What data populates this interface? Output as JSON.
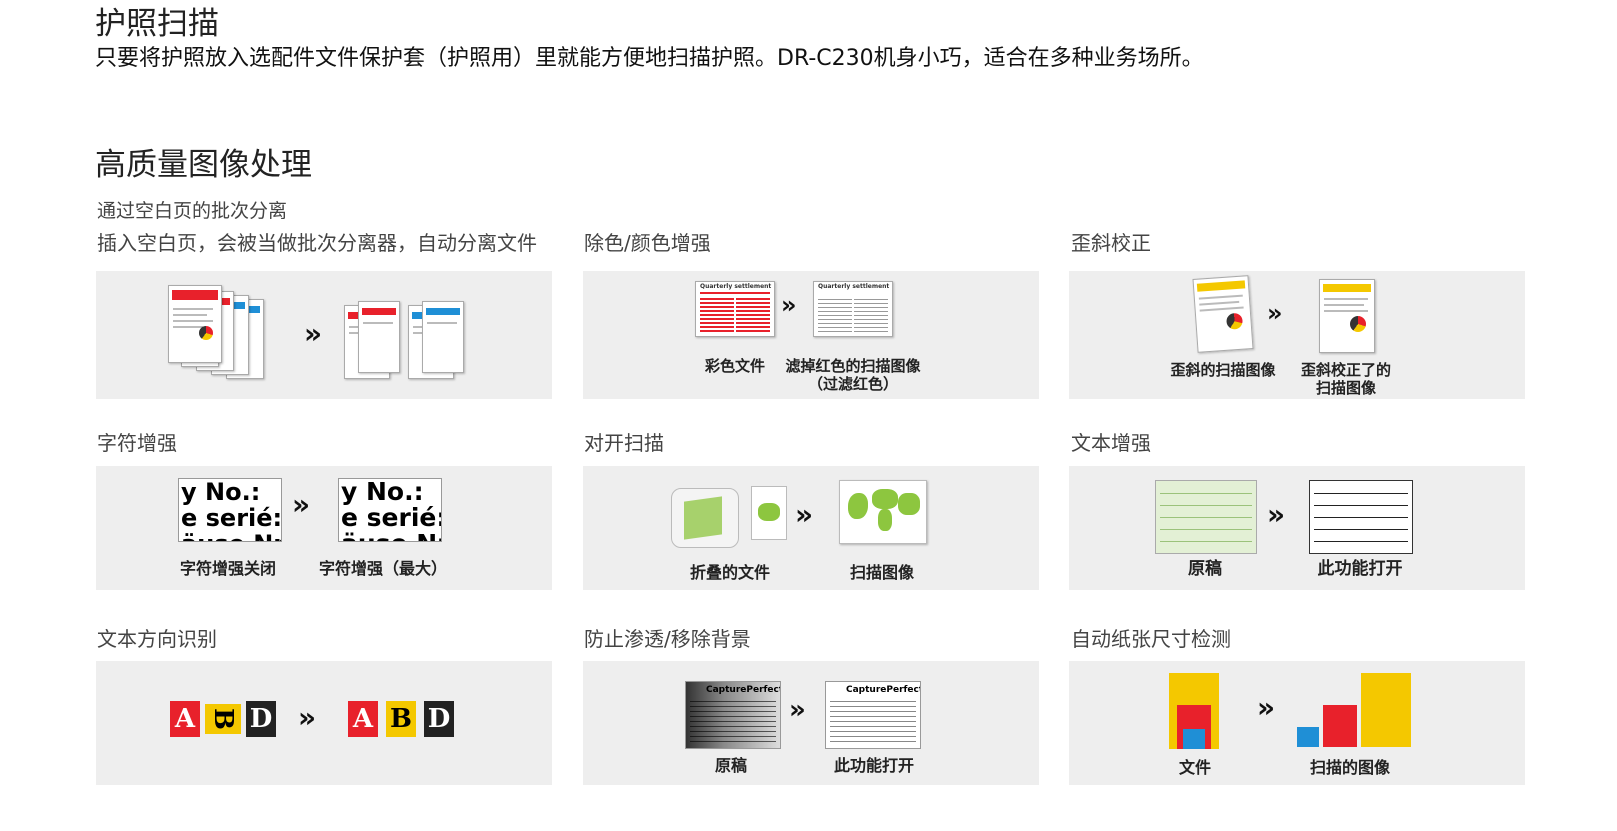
{
  "section1": {
    "title": "护照扫描",
    "description": "只要将护照放入选配件文件保护套（护照用）里就能方便地扫描护照。DR-C230机身小巧，适合在多种业务场所。"
  },
  "section2": {
    "title": "高质量图像处理",
    "features": [
      {
        "title": "通过空白页的批次分离",
        "subtitle": "插入空白页，会被当做批次分离器，自动分离文件"
      },
      {
        "title": "除色/颜色增强",
        "labels": [
          "彩色文件",
          "滤掉红色的扫描图像\n（过滤红色）"
        ],
        "doc_heading": "Quarterly settlement"
      },
      {
        "title": "歪斜校正",
        "labels": [
          "歪斜的扫描图像",
          "歪斜校正了的\n扫描图像"
        ]
      },
      {
        "title": "字符增强",
        "labels": [
          "字符增强关闭",
          "字符增强（最大）"
        ],
        "sample_text": "y No.:\ne serié:\näuse Nr"
      },
      {
        "title": "对开扫描",
        "labels": [
          "折叠的文件",
          "扫描图像"
        ]
      },
      {
        "title": "文本增强",
        "labels": [
          "原稿",
          "此功能打开"
        ]
      },
      {
        "title": "文本方向识别",
        "letters": [
          "A",
          "B",
          "D"
        ]
      },
      {
        "title": "防止渗透/移除背景",
        "labels": [
          "原稿",
          "此功能打开"
        ],
        "doc_heading": "CapturePerfect"
      },
      {
        "title": "自动纸张尺寸检测",
        "labels": [
          "文件",
          "扫描的图像"
        ]
      }
    ]
  },
  "colors": {
    "red": "#e8212b",
    "blue": "#1f8fd6",
    "yellow": "#f4c800",
    "green": "#8dc63f",
    "panel": "#eeeeee"
  },
  "arrow_glyph": "»"
}
